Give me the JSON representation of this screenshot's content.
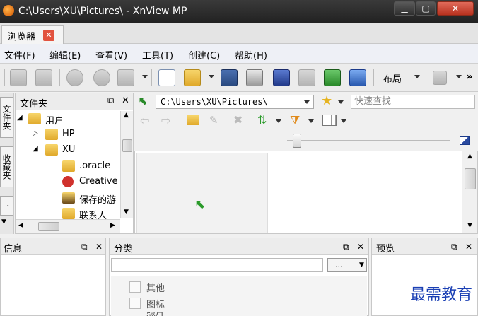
{
  "window": {
    "title": "C:\\Users\\XU\\Pictures\\ - XnView MP"
  },
  "tabs": [
    {
      "label": "浏览器",
      "close": "✕"
    }
  ],
  "menu": [
    "文件(F)",
    "编辑(E)",
    "查看(V)",
    "工具(T)",
    "创建(C)",
    "帮助(H)"
  ],
  "toolbar": {
    "layout_label": "布局",
    "more": "»"
  },
  "vtabs": [
    "文件夹",
    "收藏夹",
    "·"
  ],
  "folder_panel": {
    "title": "文件夹",
    "tree": [
      {
        "label": "用户",
        "level": 0,
        "expanded": true
      },
      {
        "label": "HP",
        "level": 1,
        "expanded": false
      },
      {
        "label": "XU",
        "level": 1,
        "expanded": true
      },
      {
        "label": ".oracle_",
        "level": 2
      },
      {
        "label": "Creative",
        "level": 2
      },
      {
        "label": "保存的游",
        "level": 2
      },
      {
        "label": "联系人",
        "level": 2
      }
    ]
  },
  "address": {
    "path": "C:\\Users\\XU\\Pictures\\",
    "search_placeholder": "快速查找"
  },
  "panels": {
    "info": {
      "title": "信息"
    },
    "category": {
      "title": "分类",
      "dropdown_label": "...",
      "items": [
        "其他",
        "图标",
        "照片"
      ]
    },
    "preview": {
      "title": "预览"
    }
  },
  "watermark": "最需教育"
}
